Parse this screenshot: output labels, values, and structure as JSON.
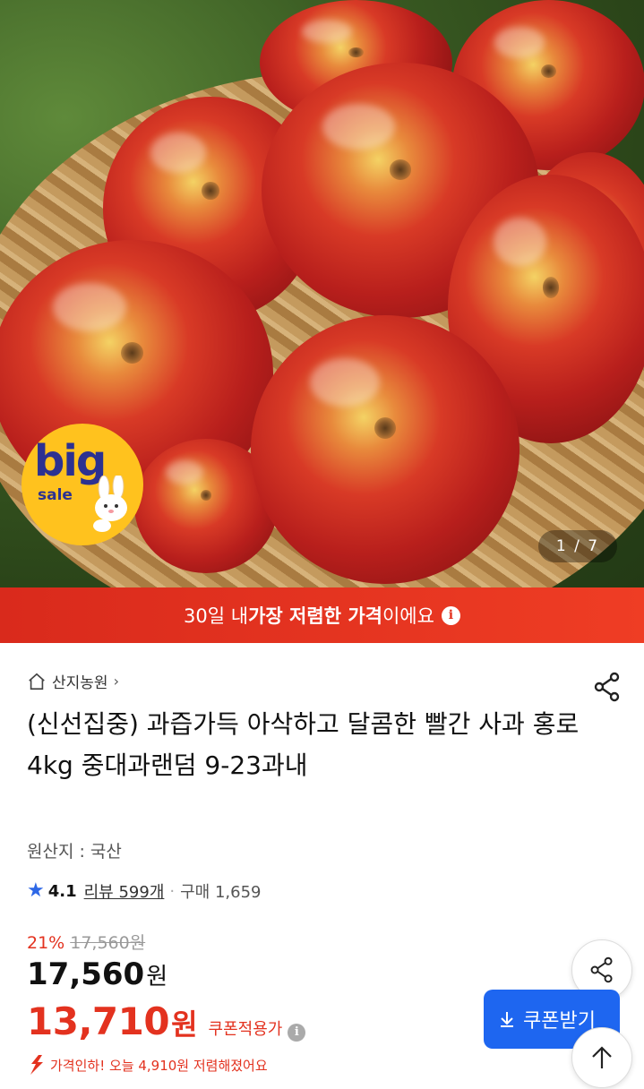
{
  "hero": {
    "image_counter": "1 / 7",
    "badge_big": "big",
    "badge_sale": "sale"
  },
  "banner": {
    "prefix": "30일 내 ",
    "highlight": "가장 저렴한 가격",
    "suffix": "이에요",
    "info_icon": "info-icon"
  },
  "store": {
    "name": "산지농원",
    "chevron": "›"
  },
  "product": {
    "title": "(신선집중) 과즙가득 아삭하고 달콤한 빨간 사과 홍로 4kg 중대과랜덤 9-23과내",
    "origin": "원산지 : 국산"
  },
  "rating": {
    "score": "4.1",
    "reviews": "리뷰 599개",
    "separator": "·",
    "purchases": "구매 1,659"
  },
  "pricing": {
    "discount_pct": "21%",
    "original_price": "17,560원",
    "price": "17,560",
    "price_unit": "원",
    "coupon_price": "13,710",
    "coupon_unit": "원",
    "coupon_label": "쿠폰적용가",
    "drop_message": "가격인하! 오늘 4,910원 저렴해졌어요"
  },
  "actions": {
    "coupon_button": "쿠폰받기",
    "coupon_icon": "download-icon",
    "share_icon": "share-icon",
    "top_icon": "arrow-up-icon"
  },
  "colors": {
    "accent_red": "#e3321f",
    "accent_blue": "#1e66f0",
    "star_blue": "#2d67e6",
    "badge_yellow": "#ffc21e"
  }
}
